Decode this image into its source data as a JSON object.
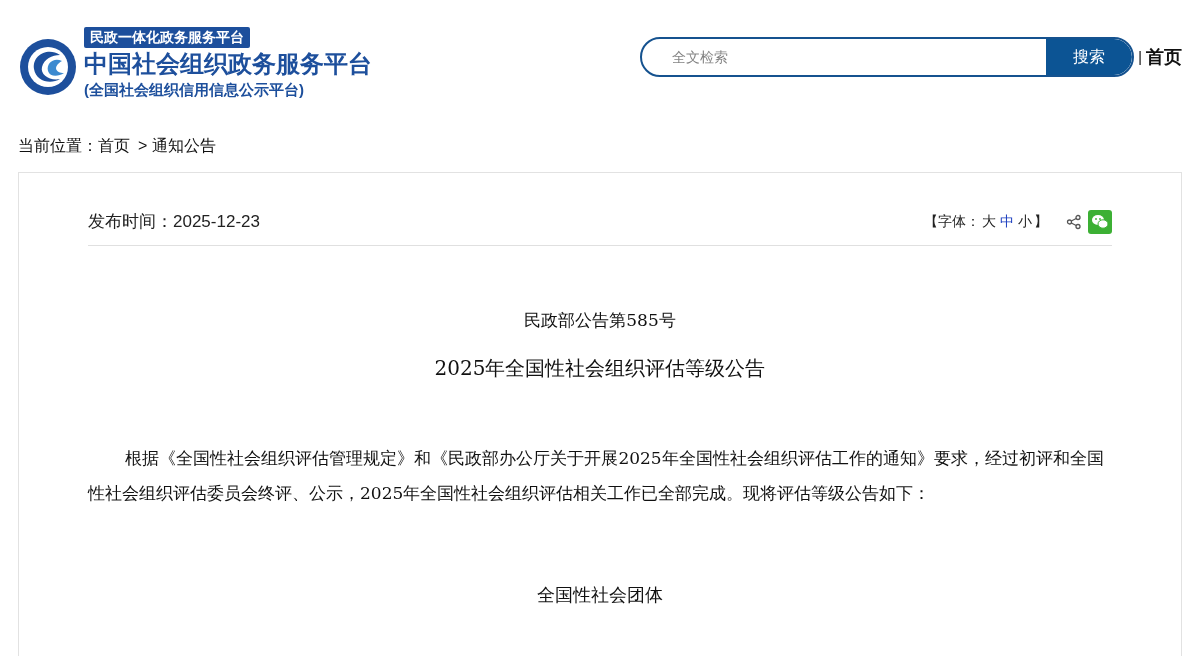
{
  "header": {
    "logo_badge": "民政一体化政务服务平台",
    "logo_title": "中国社会组织政务服务平台",
    "logo_subtitle": "(全国社会组织信用信息公示平台)",
    "search": {
      "placeholder": "全文检索",
      "button": "搜索"
    },
    "separator": "|",
    "home_link": "首页"
  },
  "breadcrumb": {
    "label": "当前位置：",
    "items": [
      {
        "text": "首页"
      },
      {
        "text": "> 通知公告"
      }
    ]
  },
  "article": {
    "publish_time": "发布时间：2025-12-23",
    "font_size": {
      "open": "【字体：",
      "close": "】",
      "options": [
        {
          "label": "大",
          "selected": false
        },
        {
          "label": "中",
          "selected": true
        },
        {
          "label": "小",
          "selected": false
        }
      ]
    },
    "notice_number": "民政部公告第585号",
    "title": "2025年全国性社会组织评估等级公告",
    "body": "根据《全国性社会组织评估管理规定》和《民政部办公厅关于开展2025年全国性社会组织评估工作的通知》要求，经过初评和全国性社会组织评估委员会终评、公示，2025年全国性社会组织评估相关工作已全部完成。现将评估等级公告如下：",
    "section_heading": "全国性社会团体"
  }
}
